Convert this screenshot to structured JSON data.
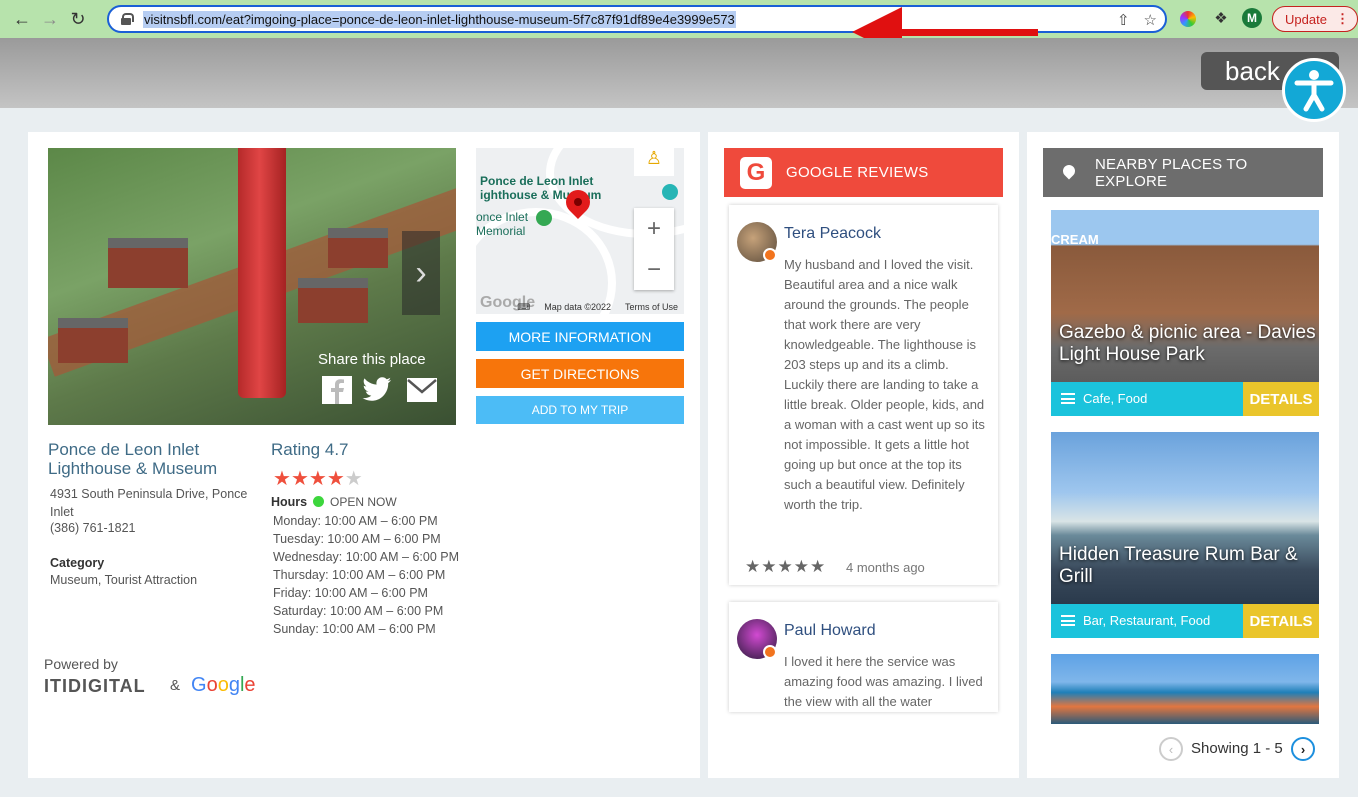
{
  "browser": {
    "url": "visitnsbfl.com/eat?imgoing-place=ponce-de-leon-inlet-lighthouse-museum-5f7c87f91df89e4e3999e573",
    "avatar_letter": "M",
    "update_label": "Update"
  },
  "header": {
    "back_label": "back"
  },
  "place": {
    "name": "Ponce de Leon Inlet Lighthouse & Museum",
    "address": "4931 South Peninsula Drive, Ponce Inlet",
    "phone": "(386) 761-1821",
    "category_heading": "Category",
    "category": "Museum, Tourist Attraction",
    "rating_label": "Rating 4.7",
    "rating_value": 4,
    "rating_max": 5,
    "hours_heading": "Hours",
    "open_status": "OPEN NOW",
    "hours": [
      "Monday: 10:00 AM – 6:00 PM",
      "Tuesday: 10:00 AM – 6:00 PM",
      "Wednesday: 10:00 AM – 6:00 PM",
      "Thursday: 10:00 AM – 6:00 PM",
      "Friday: 10:00 AM – 6:00 PM",
      "Saturday: 10:00 AM – 6:00 PM",
      "Sunday: 10:00 AM – 6:00 PM"
    ],
    "share_label": "Share this place"
  },
  "map": {
    "label_main": "Ponce de Leon Inlet Lighthouse & Museum",
    "label_line1": "Ponce de Leon Inlet",
    "label_line2": "ighthouse & Museum",
    "label_memorial1": "once Inlet",
    "label_memorial2": "Memorial",
    "map_data": "Map data ©2022",
    "terms": "Terms of Use",
    "google": "Google"
  },
  "actions": {
    "more_info": "MORE INFORMATION",
    "directions": "GET DIRECTIONS",
    "add_trip": "ADD TO MY TRIP"
  },
  "footer": {
    "powered_by": "Powered by",
    "iti": "ITIDIGITAL",
    "amp": "&",
    "google": "Google"
  },
  "reviews": {
    "title": "GOOGLE REVIEWS",
    "items": [
      {
        "name": "Tera Peacock",
        "text": "My husband and I loved the visit. Beautiful area and a nice walk around the grounds. The people that work there are very knowledgeable. The lighthouse is 203 steps up and its a climb. Luckily there are landing to take a little break. Older people, kids, and a woman with a cast went up so its not impossible. It gets a little hot going up but once at the top its such a beautiful view. Definitely worth the trip.",
        "stars": "★★★★★",
        "time": "4 months ago"
      },
      {
        "name": "Paul Howard",
        "text": "I loved it here the service was amazing food was amazing. I lived the view with all the water"
      }
    ]
  },
  "nearby": {
    "title": "NEARBY PLACES TO EXPLORE",
    "cards": [
      {
        "title": "Gazebo & picnic area - Davies Light House Park",
        "category": "Cafe, Food",
        "details": "DETAILS",
        "sign_text": "CREAM"
      },
      {
        "title": "Hidden Treasure Rum Bar & Grill",
        "category": "Bar, Restaurant, Food",
        "details": "DETAILS"
      }
    ],
    "pager": "Showing 1 - 5"
  },
  "colors": {
    "reviews_header": "#ef4a3c",
    "nearby_header": "#6d6d6d",
    "details_btn": "#eac52b",
    "card_bar": "#1bc3dc",
    "more_info_btn": "#1da1f2",
    "directions_btn": "#f7750b",
    "add_trip_btn": "#4cbcf6"
  }
}
